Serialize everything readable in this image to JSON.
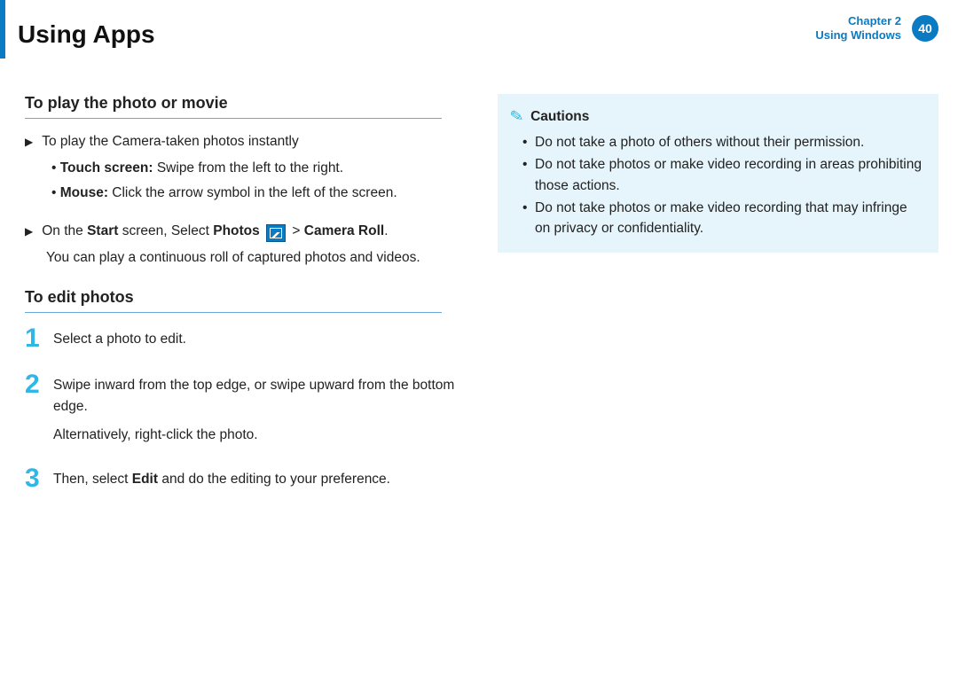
{
  "header": {
    "title": "Using Apps",
    "chapter_line1": "Chapter 2",
    "chapter_line2": "Using Windows",
    "page_number": "40"
  },
  "left": {
    "section1_title": "To play the photo or movie",
    "play_intro": "To play the Camera-taken photos instantly",
    "touch_label": "Touch screen:",
    "touch_text": " Swipe from the left to the right.",
    "mouse_label": "Mouse:",
    "mouse_text": " Click the arrow symbol in the left of the screen.",
    "start_prefix": "On the ",
    "start_bold1": "Start",
    "start_mid": " screen, Select ",
    "start_bold2": "Photos",
    "start_gt": " > ",
    "start_bold3": "Camera Roll",
    "start_period": ".",
    "start_desc": "You can play a continuous roll of captured photos and videos.",
    "section2_title": "To edit photos",
    "steps": [
      {
        "num": "1",
        "lines": [
          "Select a photo to edit."
        ]
      },
      {
        "num": "2",
        "lines": [
          "Swipe inward from the top edge, or swipe upward from the bottom edge.",
          "Alternatively, right-click the photo."
        ]
      },
      {
        "num": "3",
        "bold": "Edit",
        "prefix": "Then, select ",
        "suffix": " and do the editing to your preference."
      }
    ]
  },
  "right": {
    "cautions_title": "Cautions",
    "items": [
      "Do not take a photo of others without their permission.",
      "Do not take photos or make video recording in areas prohibiting those actions.",
      "Do not take photos or make video recording that may infringe on privacy or confidentiality."
    ]
  }
}
